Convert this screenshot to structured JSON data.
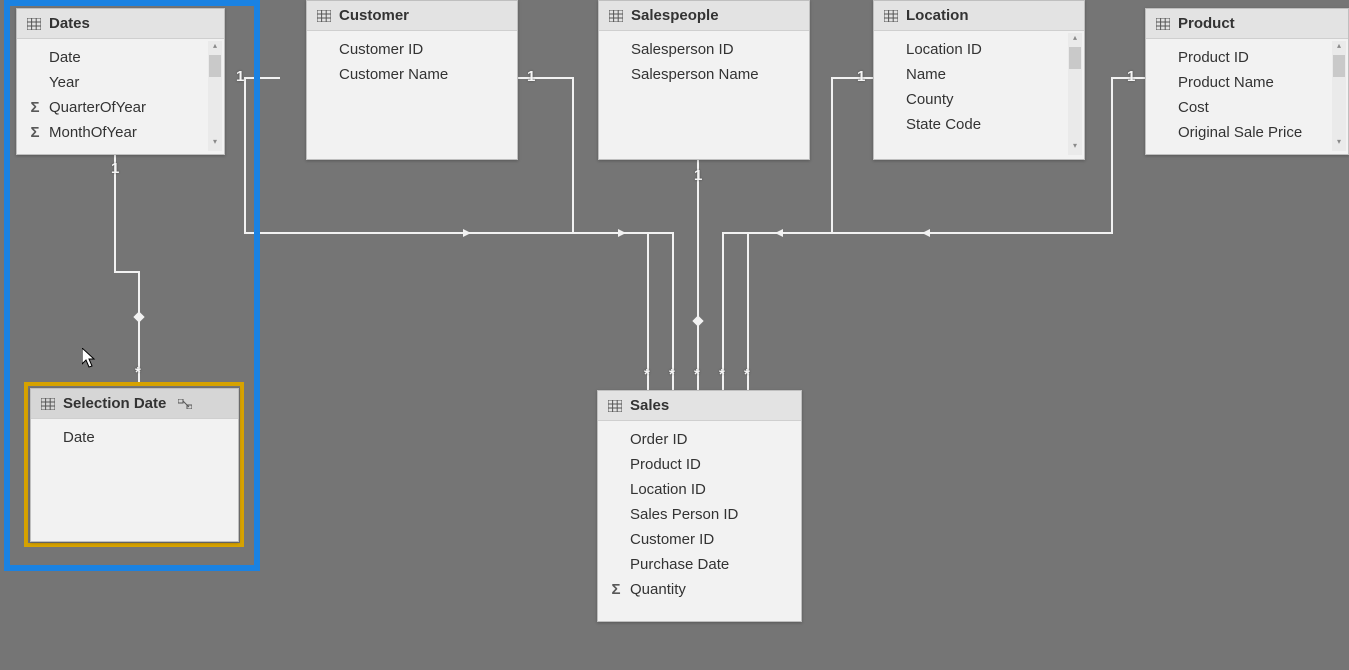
{
  "tables": {
    "dates": {
      "title": "Dates",
      "fields": [
        "Date",
        "Year",
        "QuarterOfYear",
        "MonthOfYear"
      ],
      "sigma_indices": [
        2,
        3
      ]
    },
    "customer": {
      "title": "Customer",
      "fields": [
        "Customer ID",
        "Customer Name"
      ]
    },
    "salespeople": {
      "title": "Salespeople",
      "fields": [
        "Salesperson ID",
        "Salesperson Name"
      ]
    },
    "location": {
      "title": "Location",
      "fields": [
        "Location ID",
        "Name",
        "County",
        "State Code"
      ],
      "has_scrollbar": true
    },
    "product": {
      "title": "Product",
      "fields": [
        "Product ID",
        "Product Name",
        "Cost",
        "Original Sale Price"
      ],
      "has_scrollbar": true
    },
    "selection_date": {
      "title": "Selection Date",
      "fields": [
        "Date"
      ]
    },
    "sales": {
      "title": "Sales",
      "fields": [
        "Order ID",
        "Product ID",
        "Location ID",
        "Sales Person ID",
        "Customer ID",
        "Purchase Date",
        "Quantity"
      ],
      "sigma_indices": [
        6
      ]
    }
  },
  "cardinality_labels": {
    "one": "1",
    "many": "*"
  }
}
